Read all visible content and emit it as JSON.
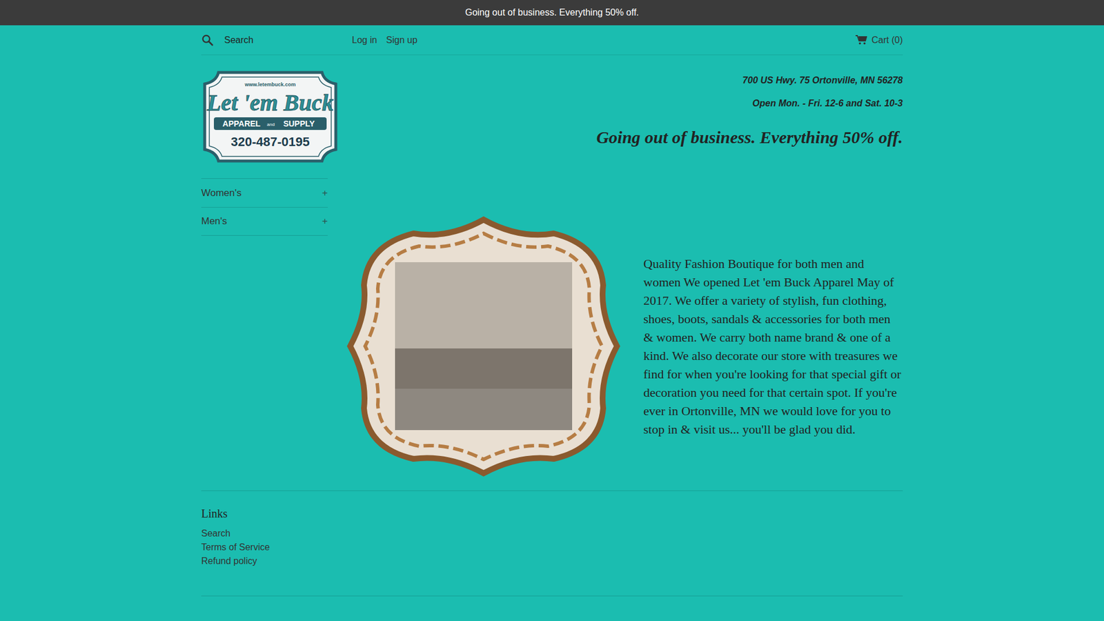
{
  "announcement": "Going out of business. Everything 50% off.",
  "header": {
    "search_placeholder": "Search",
    "links": [
      "Log in",
      "Sign up"
    ],
    "cart": "Cart (0)"
  },
  "logo": {
    "url": "www.letembuck.com",
    "name": "Let 'em Buck",
    "word_left": "APPAREL",
    "word_mid": "and",
    "word_right": "SUPPLY",
    "phone": "320-487-0195"
  },
  "store_info": {
    "address": "700 US Hwy. 75 Ortonville, MN 56278",
    "hours": "Open Mon. - Fri. 12-6 and Sat. 10-3",
    "banner": "Going out of business. Everything 50% off."
  },
  "sidebar": {
    "items": [
      {
        "label": "Women's",
        "toggle": "+",
        "expanded": false
      },
      {
        "label": "Men's",
        "toggle": "+",
        "expanded": false
      }
    ]
  },
  "about": "Quality Fashion Boutique for both men and women We opened Let 'em Buck Apparel May of 2017. We offer a variety of stylish, fun clothing, shoes, boots, sandals & accessories for both men & women. We carry both name brand & one of a kind. We also decorate our store with treasures we find for when you're looking for that special gift or decoration you need for that certain spot. If you're ever in Ortonville, MN we would love for you to stop in & visit us... you'll be glad you did.",
  "footer": {
    "heading": "Links",
    "links": [
      "Search",
      "Terms of Service",
      "Refund policy"
    ]
  }
}
